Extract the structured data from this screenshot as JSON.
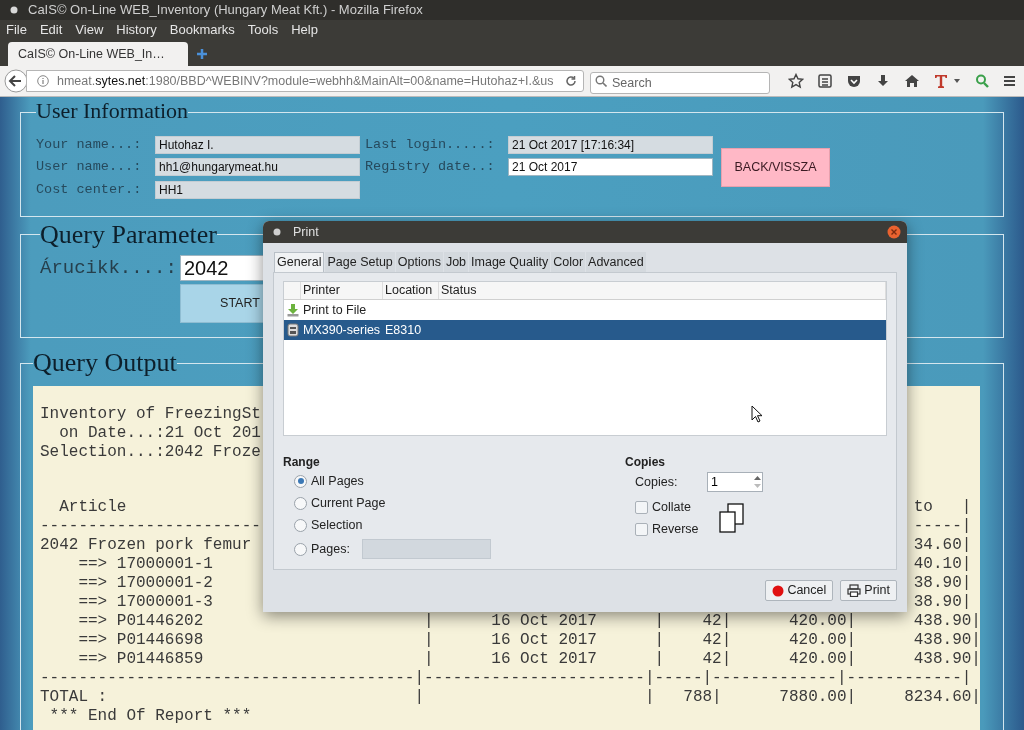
{
  "window": {
    "title": "CaIS© On-Line WEB_Inventory (Hungary Meat Kft.) - Mozilla Firefox"
  },
  "menu": [
    "File",
    "Edit",
    "View",
    "History",
    "Bookmarks",
    "Tools",
    "Help"
  ],
  "tabs": [
    {
      "label": "CaIS© On-Line WEB_In…",
      "selected": true
    }
  ],
  "address_bar": {
    "url": "hmeat.**sytes.net**:1980/BBD^WEBINV?module=webhh&MainAlt=00&name=Hutohaz+I.&us"
  },
  "search": {
    "placeholder": "Search"
  },
  "user_information": {
    "title": "User Information",
    "fields": [
      {
        "label": "Your name...:",
        "value": "Hutohaz I.",
        "readonly": true
      },
      {
        "label": "Last login.....:",
        "value": "21 Oct 2017 [17:16:34]",
        "readonly": true
      },
      {
        "label": "User name...:",
        "value": "hh1@hungarymeat.hu",
        "readonly": true
      },
      {
        "label": "Registry date..:",
        "value": "21 Oct 2017",
        "readonly": false
      },
      {
        "label": "Cost center.:",
        "value": "HH1",
        "readonly": true
      }
    ],
    "back_button": "BACK/VISSZA"
  },
  "query_parameters": {
    "title": "Query Parameter",
    "label": "Árucikk....:",
    "value": "2042",
    "button": "START"
  },
  "query_output": {
    "title": "Query Output",
    "heading_lines": [
      "Inventory of FreezingSt",
      "  on Date...:21 Oct 201",
      "Selection...:2042 Froze"
    ],
    "table_lines": [
      {
        "left": "  Article",
        "right": "to   |"
      },
      {
        "left": "-----------------------",
        "right": "-----|"
      },
      {
        "left": "2042 Frozen pork femur",
        "right": "34.60|"
      },
      {
        "left": "    ==> 17000001-1",
        "right": "40.10|"
      },
      {
        "left": "    ==> 17000001-2",
        "right": "38.90|"
      },
      {
        "left": "    ==> 17000001-3",
        "right": "38.90|"
      },
      {
        "left": "    ==> P01446202                       |      16 Oct 2017      |    42|      420.00|      438.90|"
      },
      {
        "left": "    ==> P01446698                       |      16 Oct 2017      |    42|      420.00|      438.90|"
      },
      {
        "left": "    ==> P01446859                       |      16 Oct 2017      |    42|      420.00|      438.90|"
      },
      {
        "left": "---------------------------------------|-----------------------|-----|-------------|------------|"
      },
      {
        "left": "TOTAL :                                |                       |   788|      7880.00|     8234.60|"
      },
      {
        "left": " *** End Of Report ***"
      }
    ]
  },
  "print_dialog": {
    "title": "Print",
    "tabs": [
      {
        "label": "General",
        "selected": true
      },
      {
        "label": "Page Setup",
        "selected": false
      },
      {
        "label": "Options",
        "selected": false
      },
      {
        "label": "Job",
        "selected": false
      },
      {
        "label": "Image Quality",
        "selected": false
      },
      {
        "label": "Color",
        "selected": false
      },
      {
        "label": "Advanced",
        "selected": false
      }
    ],
    "columns": [
      "Printer",
      "Location",
      "Status"
    ],
    "printers": [
      {
        "name": "Print to File",
        "kind": "file",
        "selected": false
      },
      {
        "name": "MX390-series",
        "location": "E8310",
        "kind": "printer",
        "selected": true
      }
    ],
    "range": {
      "title": "Range",
      "options": [
        {
          "label": "All Pages",
          "selected": true
        },
        {
          "label": "Current Page",
          "selected": false
        },
        {
          "label": "Selection",
          "selected": false
        },
        {
          "label": "Pages:",
          "selected": false,
          "kind": "pages"
        }
      ]
    },
    "copies": {
      "title": "Copies",
      "label": "Copies:",
      "value": "1",
      "checkboxes": [
        {
          "label": "Collate",
          "checked": false
        },
        {
          "label": "Reverse",
          "checked": false
        }
      ]
    },
    "buttons": [
      {
        "label": "Cancel",
        "kind": "cancel"
      },
      {
        "label": "Print",
        "kind": "print"
      }
    ]
  }
}
